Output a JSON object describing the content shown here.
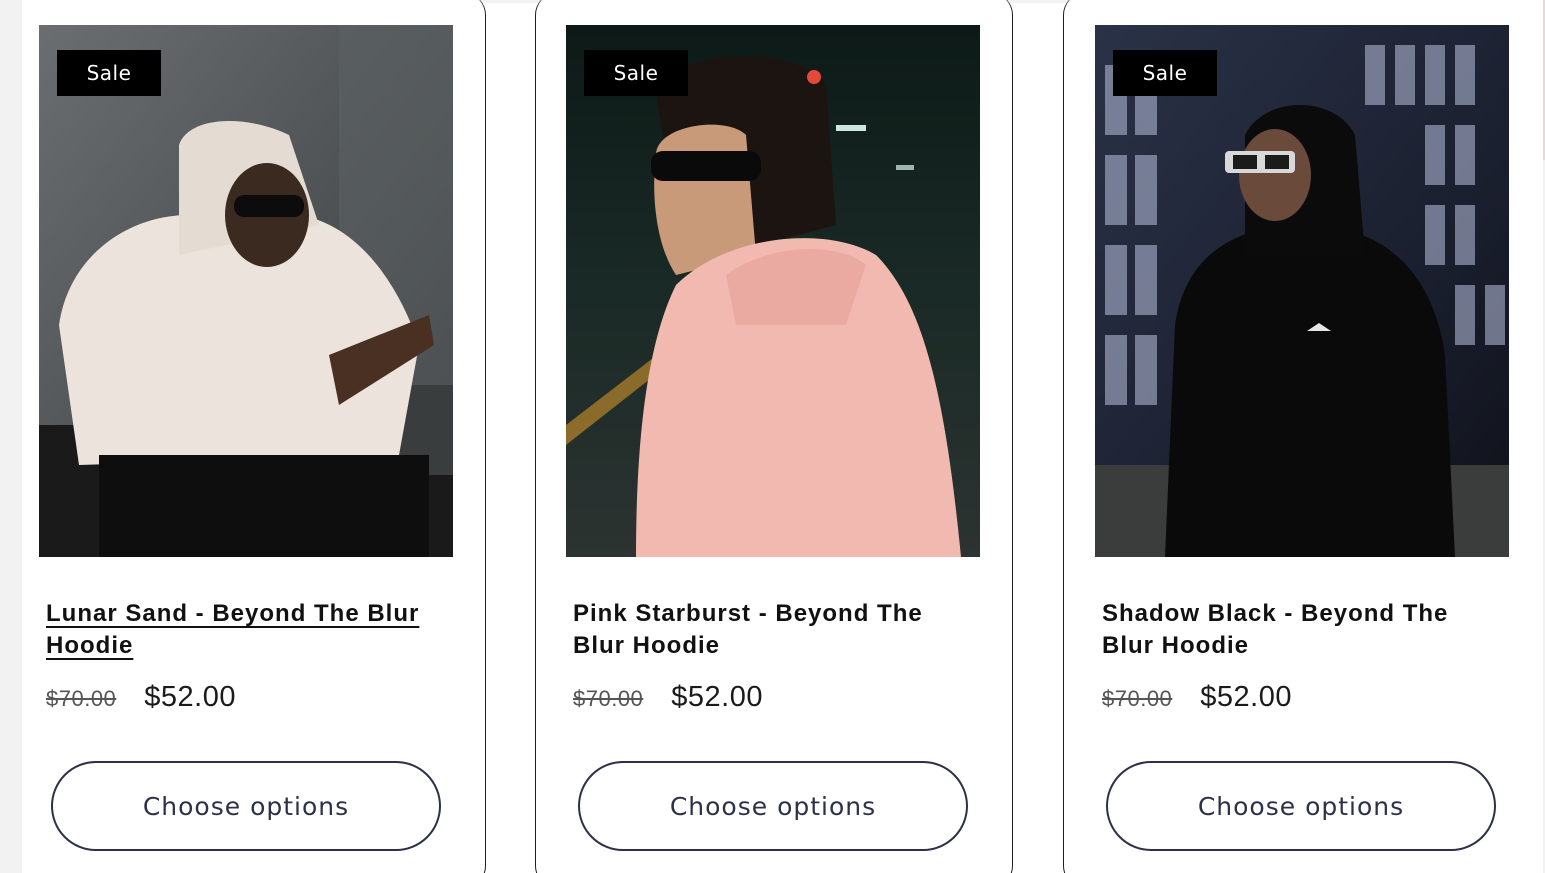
{
  "colors": {
    "badge_bg": "#000000",
    "button_border": "#2d3148",
    "text": "#111111"
  },
  "products": [
    {
      "badge": "Sale",
      "title": "Lunar Sand - Beyond The Blur Hoodie",
      "compare_price": "$70.00",
      "price": "$52.00",
      "button": "Choose options",
      "image": "model-cream-hoodie-photo"
    },
    {
      "badge": "Sale",
      "title": "Pink Starburst - Beyond The Blur Hoodie",
      "compare_price": "$70.00",
      "price": "$52.00",
      "button": "Choose options",
      "image": "model-pink-hoodie-photo"
    },
    {
      "badge": "Sale",
      "title": "Shadow Black - Beyond The Blur Hoodie",
      "compare_price": "$70.00",
      "price": "$52.00",
      "button": "Choose options",
      "image": "model-black-hoodie-photo"
    }
  ]
}
